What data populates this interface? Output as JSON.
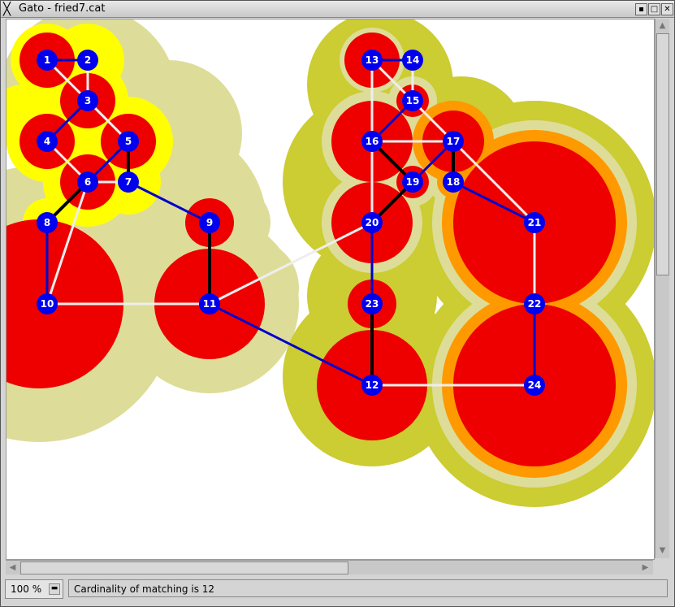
{
  "window": {
    "title": "Gato - fried7.cat",
    "close_glyph": "╳",
    "buttons": [
      "▪",
      "□",
      "✕"
    ]
  },
  "scroll": {
    "up": "▲",
    "down": "▼",
    "left": "◀",
    "right": "▶"
  },
  "status": {
    "zoom_value": "100 %",
    "zoom_glyph": "▬",
    "message": "Cardinality of matching is 12"
  },
  "colors": {
    "vertex": "#0000ee",
    "matched_edge": "#000000",
    "tree_edge": "#0000cc",
    "plain_edge": "#eeeeee",
    "blossom_inner": "#ee0000",
    "blossom_yellow": "#ffff00",
    "blossom_olive": "#cccc33",
    "blossom_tan": "#dddd99",
    "blossom_orange": "#ff9900"
  },
  "graph": {
    "vertices": [
      {
        "id": "1",
        "label": "1"
      },
      {
        "id": "2",
        "label": "2"
      },
      {
        "id": "3",
        "label": "3"
      },
      {
        "id": "4",
        "label": "4"
      },
      {
        "id": "5",
        "label": "5"
      },
      {
        "id": "6",
        "label": "6"
      },
      {
        "id": "7",
        "label": "7"
      },
      {
        "id": "8",
        "label": "8"
      },
      {
        "id": "9",
        "label": "9"
      },
      {
        "id": "10",
        "label": "10"
      },
      {
        "id": "11",
        "label": "11"
      },
      {
        "id": "12",
        "label": "12"
      },
      {
        "id": "13",
        "label": "13"
      },
      {
        "id": "14",
        "label": "14"
      },
      {
        "id": "15",
        "label": "15"
      },
      {
        "id": "16",
        "label": "16"
      },
      {
        "id": "17",
        "label": "17"
      },
      {
        "id": "18",
        "label": "18"
      },
      {
        "id": "19",
        "label": "19"
      },
      {
        "id": "20",
        "label": "20"
      },
      {
        "id": "21",
        "label": "21"
      },
      {
        "id": "22",
        "label": "22"
      },
      {
        "id": "23",
        "label": "23"
      },
      {
        "id": "24",
        "label": "24"
      }
    ],
    "edges": [
      {
        "from": "1",
        "to": "2",
        "kind": "tree"
      },
      {
        "from": "1",
        "to": "3",
        "kind": "plain"
      },
      {
        "from": "2",
        "to": "3",
        "kind": "plain"
      },
      {
        "from": "3",
        "to": "4",
        "kind": "tree"
      },
      {
        "from": "3",
        "to": "5",
        "kind": "plain"
      },
      {
        "from": "4",
        "to": "6",
        "kind": "plain"
      },
      {
        "from": "5",
        "to": "6",
        "kind": "tree"
      },
      {
        "from": "5",
        "to": "7",
        "kind": "matched"
      },
      {
        "from": "6",
        "to": "7",
        "kind": "plain"
      },
      {
        "from": "6",
        "to": "8",
        "kind": "matched"
      },
      {
        "from": "6",
        "to": "10",
        "kind": "plain"
      },
      {
        "from": "7",
        "to": "9",
        "kind": "tree"
      },
      {
        "from": "8",
        "to": "10",
        "kind": "tree"
      },
      {
        "from": "9",
        "to": "11",
        "kind": "matched"
      },
      {
        "from": "10",
        "to": "11",
        "kind": "plain"
      },
      {
        "from": "11",
        "to": "20",
        "kind": "plain"
      },
      {
        "from": "11",
        "to": "12",
        "kind": "tree"
      },
      {
        "from": "12",
        "to": "23",
        "kind": "matched"
      },
      {
        "from": "12",
        "to": "24",
        "kind": "plain"
      },
      {
        "from": "13",
        "to": "14",
        "kind": "tree"
      },
      {
        "from": "13",
        "to": "16",
        "kind": "plain"
      },
      {
        "from": "13",
        "to": "15",
        "kind": "plain"
      },
      {
        "from": "14",
        "to": "15",
        "kind": "plain"
      },
      {
        "from": "15",
        "to": "16",
        "kind": "tree"
      },
      {
        "from": "15",
        "to": "17",
        "kind": "plain"
      },
      {
        "from": "16",
        "to": "17",
        "kind": "plain"
      },
      {
        "from": "16",
        "to": "19",
        "kind": "matched"
      },
      {
        "from": "16",
        "to": "20",
        "kind": "plain"
      },
      {
        "from": "17",
        "to": "19",
        "kind": "tree"
      },
      {
        "from": "17",
        "to": "18",
        "kind": "matched"
      },
      {
        "from": "17",
        "to": "21",
        "kind": "plain"
      },
      {
        "from": "18",
        "to": "21",
        "kind": "tree"
      },
      {
        "from": "19",
        "to": "20",
        "kind": "matched"
      },
      {
        "from": "20",
        "to": "23",
        "kind": "tree"
      },
      {
        "from": "21",
        "to": "22",
        "kind": "plain"
      },
      {
        "from": "22",
        "to": "24",
        "kind": "tree"
      }
    ]
  }
}
